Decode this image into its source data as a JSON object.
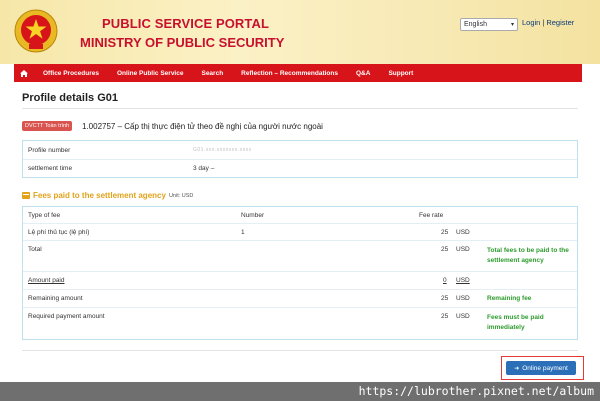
{
  "header": {
    "portal_title": "PUBLIC SERVICE PORTAL",
    "ministry_title": "MINISTRY OF PUBLIC SECURITY",
    "language_selected": "English",
    "login_label": "Login",
    "separator": "|",
    "register_label": "Register",
    "colors": {
      "title": "#c8102e",
      "nav": "#d7141a"
    }
  },
  "nav": {
    "home_icon": "home-icon",
    "items": [
      "Office Procedures",
      "Online Public Service",
      "Search",
      "Reflection – Recommendations",
      "Q&A",
      "Support"
    ]
  },
  "page": {
    "title": "Profile details G01",
    "procedure_badge": "DVCTT Toàn trình",
    "procedure_name": "1.002757 – Cấp thị thực điện tử theo đề nghị của người nước ngoài"
  },
  "profile": {
    "rows": [
      {
        "label": "Profile number",
        "value": "G01.xxx.xxxxxxx.xxxx"
      },
      {
        "label": "settlement time",
        "value": "3 day –"
      }
    ]
  },
  "fees": {
    "heading": "Fees paid to the settlement agency",
    "unit": "Unit: USD",
    "columns": {
      "type": "Type of fee",
      "number": "Number",
      "rate": "Fee rate"
    },
    "item": {
      "type": "Lệ phí thủ tục (lệ phí)",
      "number": "1",
      "amount": "25",
      "currency": "USD"
    },
    "total": {
      "label": "Total",
      "amount": "25",
      "currency": "USD",
      "note": "Total fees to be paid to the settlement agency"
    },
    "paid": {
      "label": "Amount paid",
      "amount": "0",
      "currency": "USD"
    },
    "remaining": {
      "label": "Remaining amount",
      "amount": "25",
      "currency": "USD",
      "note": "Remaining fee"
    },
    "required": {
      "label": "Required payment amount",
      "amount": "25",
      "currency": "USD",
      "note": "Fees must be paid immediately"
    }
  },
  "actions": {
    "online_payment_label": "Online payment"
  },
  "watermark": "https://lubrother.pixnet.net/album"
}
